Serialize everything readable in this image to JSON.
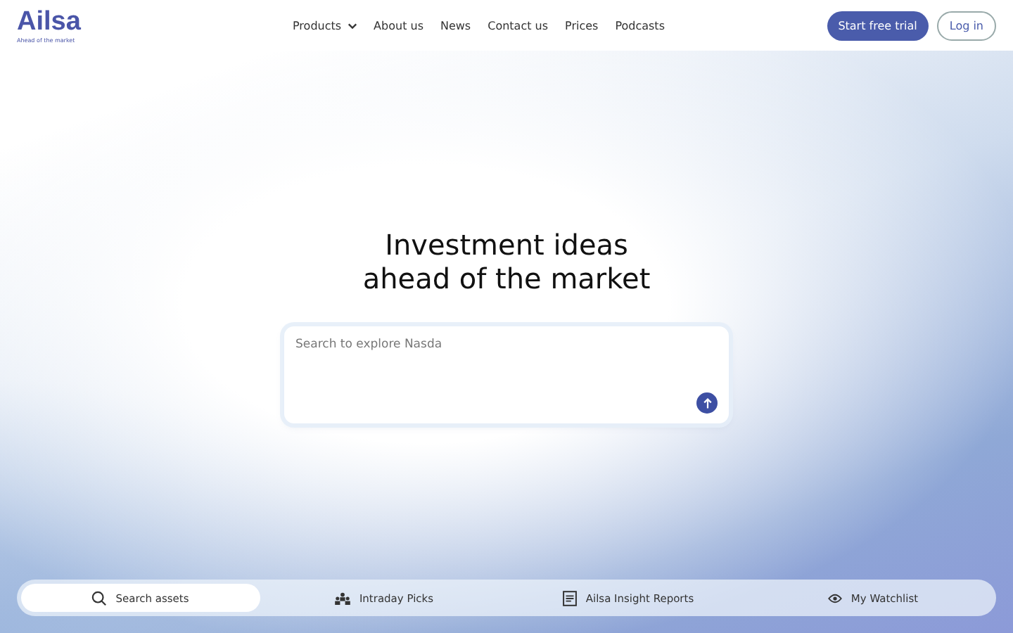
{
  "logo": {
    "name": "Ailsa",
    "tagline": "Ahead of the market"
  },
  "nav": [
    {
      "label": "Products",
      "has_menu": true
    },
    {
      "label": "About us",
      "has_menu": false
    },
    {
      "label": "News",
      "has_menu": false
    },
    {
      "label": "Contact us",
      "has_menu": false
    },
    {
      "label": "Prices",
      "has_menu": false
    },
    {
      "label": "Podcasts",
      "has_menu": false
    }
  ],
  "actions": {
    "primary": "Start free trial",
    "secondary": "Log in"
  },
  "hero": {
    "title_lines": [
      "Investment ideas",
      "ahead of the market"
    ]
  },
  "search": {
    "placeholder": "Search to explore Nasda"
  },
  "bottom_tabs": [
    {
      "label": "Search assets",
      "kind": "search",
      "selected": true
    },
    {
      "label": "Intraday Picks",
      "kind": "picks",
      "selected": false
    },
    {
      "label": "Ailsa Insight Reports",
      "kind": "reports",
      "selected": false
    },
    {
      "label": "My Watchlist",
      "kind": "watchlist",
      "selected": false
    }
  ]
}
